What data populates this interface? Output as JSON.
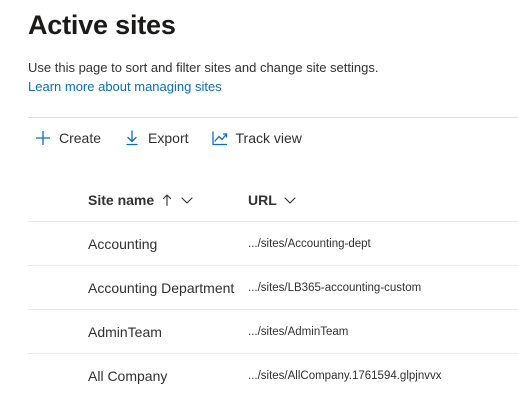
{
  "header": {
    "title": "Active sites",
    "description": "Use this page to sort and filter sites and change site settings.",
    "learn_more_link": "Learn more about managing sites"
  },
  "toolbar": {
    "create_label": "Create",
    "export_label": "Export",
    "track_view_label": "Track view"
  },
  "table": {
    "columns": {
      "site_name": "Site name",
      "url": "URL"
    },
    "sort": {
      "column": "site_name",
      "direction": "ascending"
    },
    "rows": [
      {
        "site_name": "Accounting",
        "url": ".../sites/Accounting-dept"
      },
      {
        "site_name": "Accounting Department",
        "url": ".../sites/LB365-accounting-custom"
      },
      {
        "site_name": "AdminTeam",
        "url": ".../sites/AdminTeam"
      },
      {
        "site_name": "All Company",
        "url": ".../sites/AllCompany.1761594.glpjnvvx"
      }
    ]
  },
  "icons": {
    "create": "plus-icon",
    "export": "download-arrow-icon",
    "track_view": "line-chart-icon",
    "sort": "arrow-up-icon",
    "column_menu": "chevron-down-icon"
  },
  "colors": {
    "link": "#0f6cbd",
    "accent_icon": "#0f6cbd",
    "text": "#323130",
    "divider": "#e1dfdd"
  }
}
